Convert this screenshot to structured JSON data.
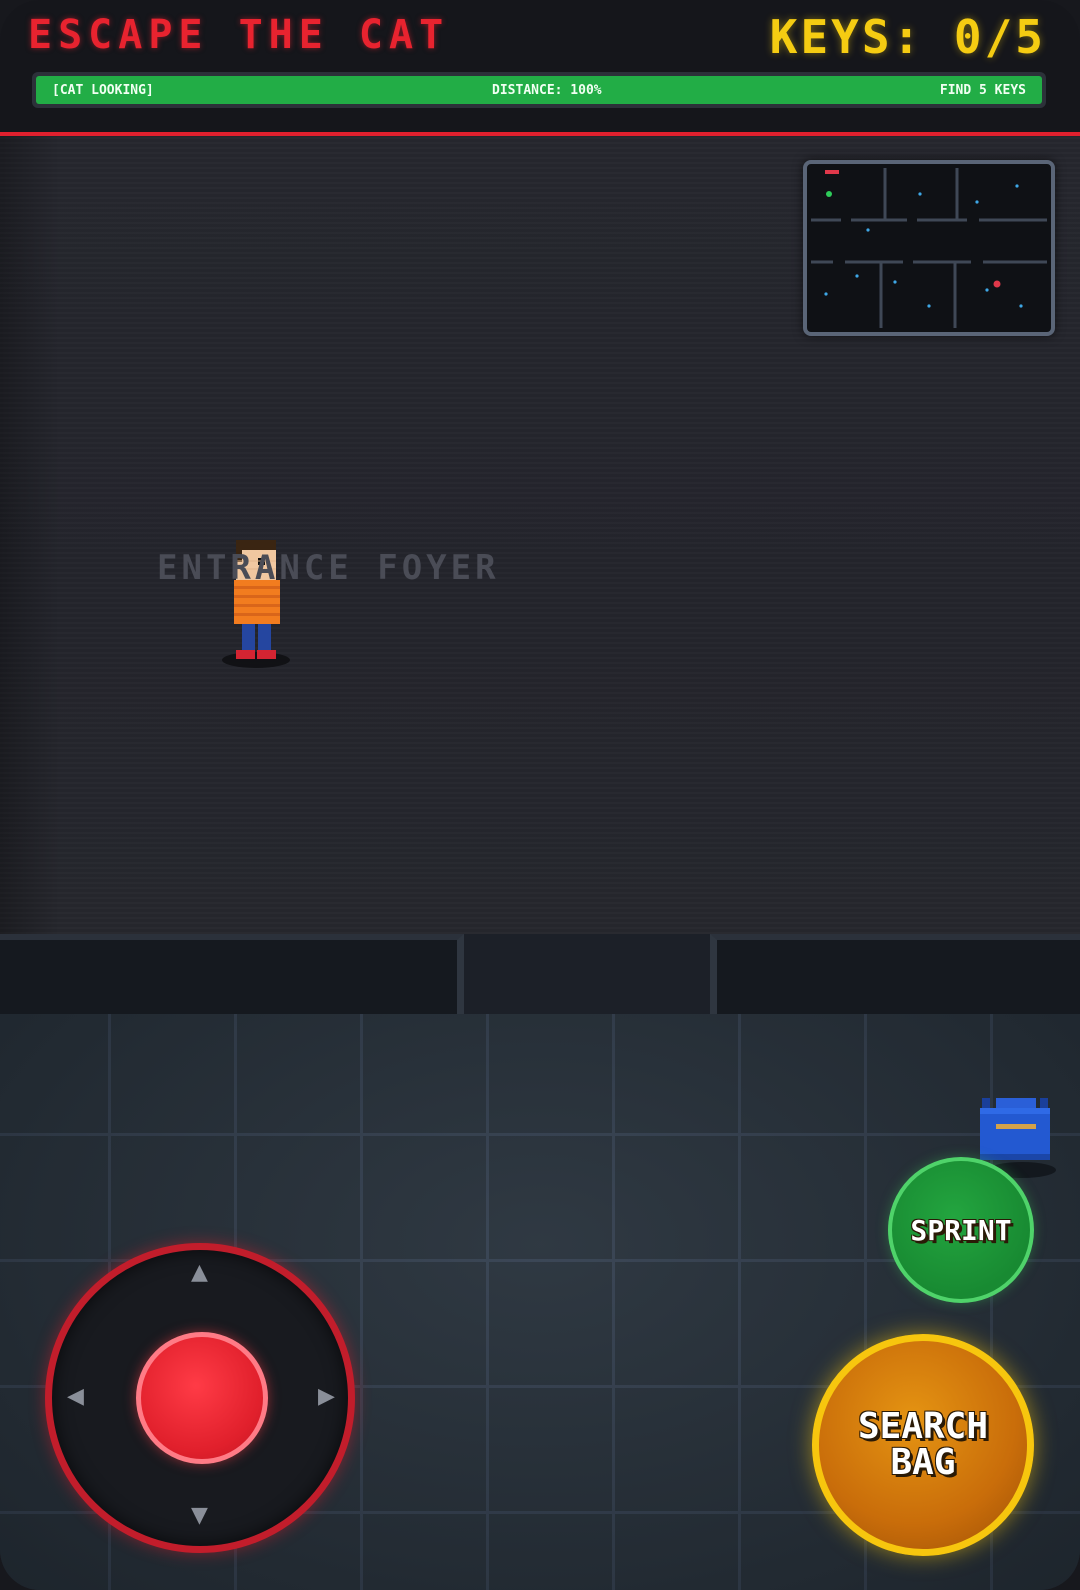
{
  "hud": {
    "title": "ESCAPE THE CAT",
    "keys_label": "KEYS: 0/5",
    "status": {
      "left": "[CAT LOOKING]",
      "center": "DISTANCE: 100%",
      "right": "FIND 5 KEYS",
      "fill_fraction": 1.0
    }
  },
  "room": {
    "label": "ENTRANCE FOYER"
  },
  "controls": {
    "joystick_icon": "joystick",
    "sprint_label": "SPRINT",
    "search_label": "SEARCH\nBAG"
  },
  "items": {
    "bag_icon": "backpack-icon"
  },
  "colors": {
    "accent_red": "#e8232f",
    "keys_yellow": "#f5cc12",
    "status_green": "#22ad46",
    "sprint_green": "#188a32",
    "search_orange": "#c96d0a"
  }
}
